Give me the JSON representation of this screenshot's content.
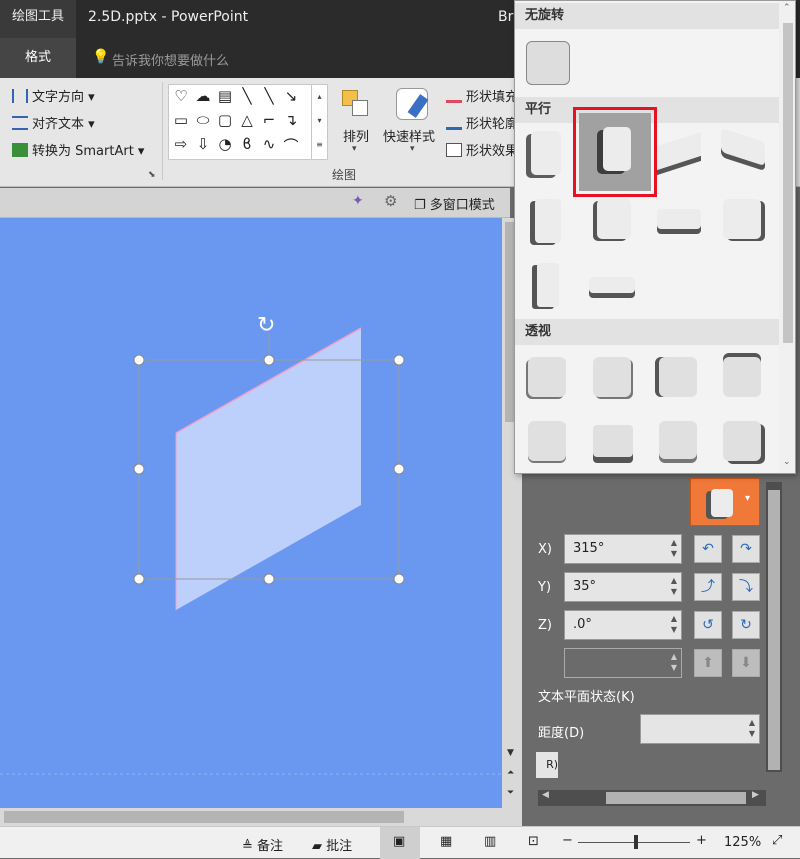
{
  "titlebar": {
    "context_tab": "绘图工具",
    "title": "2.5D.pptx  -  PowerPoint",
    "user_short": "Br"
  },
  "tabs": {
    "format": "格式",
    "tell_me": "告诉我你想要做什么"
  },
  "ribbon": {
    "text_direction": "文字方向",
    "align_text": "对齐文本",
    "convert_smartart": "转换为 SmartArt",
    "arrange": "排列",
    "quick_styles": "快速样式",
    "shape_fill": "形状填充",
    "shape_outline": "形状轮廓",
    "shape_effects": "形状效果",
    "group_drawing": "绘图"
  },
  "subbar": {
    "multi_window": "多窗口模式"
  },
  "dropdown": {
    "section_no_rotation": "无旋转",
    "section_parallel": "平行",
    "section_perspective": "透视"
  },
  "pane": {
    "x_label": "X)",
    "x_value": "315°",
    "y_label": "Y)",
    "y_value": "35°",
    "z_label": "Z)",
    "z_value": ".0°",
    "text_flat": "文本平面状态(K)",
    "distance_label": "距度(D)",
    "reset_label": "R)"
  },
  "statusbar": {
    "notes": "备注",
    "comments": "批注",
    "zoom": "125%"
  },
  "colors": {
    "slide_bg": "#6a98f0",
    "shape_fill": "#bcd0fb",
    "selection_highlight": "#e81123",
    "preset_button": "#f07838"
  }
}
